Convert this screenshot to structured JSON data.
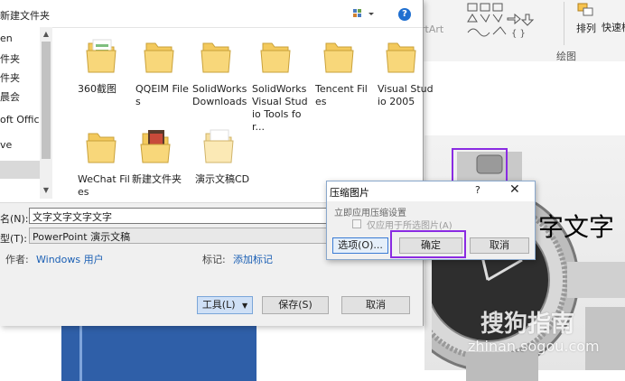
{
  "save_dialog": {
    "toolbar": {
      "new_folder": "新建文件夹"
    },
    "nav": [
      "en",
      "件夹",
      "件夹",
      "晨会",
      "oft Office",
      "ve"
    ],
    "files": [
      {
        "name": "360截图",
        "kind": "folder"
      },
      {
        "name": "QQEIM Files",
        "kind": "folder"
      },
      {
        "name": "SolidWorks Downloads",
        "kind": "folder"
      },
      {
        "name": "SolidWorks Visual Studio Tools for...",
        "kind": "folder"
      },
      {
        "name": "Tencent Files",
        "kind": "folder"
      },
      {
        "name": "Visual Studio 2005",
        "kind": "folder"
      },
      {
        "name": "WeChat Files",
        "kind": "folder"
      },
      {
        "name": "新建文件夹",
        "kind": "folder-photo"
      },
      {
        "name": "演示文稿CD",
        "kind": "folder-light"
      }
    ],
    "filename_label": "名(N):",
    "filename_value": "文字文字文字文字",
    "filetype_label": "型(T):",
    "filetype_value": "PowerPoint 演示文稿",
    "author_label": "作者:",
    "author_value": "Windows 用户",
    "tags_label": "标记:",
    "tags_value": "添加标记",
    "tools_button": "工具(L)",
    "save_button": "保存(S)",
    "cancel_button": "取消"
  },
  "compress_dialog": {
    "title": "压缩图片",
    "help": "?",
    "close": "✕",
    "section": "立即应用压缩设置",
    "checkbox_label": "仅应用于所选图片(A)",
    "checkbox_checked": false,
    "options_button": "选项(O)...",
    "ok_button": "确定",
    "cancel_button": "取消"
  },
  "ribbon": {
    "art_text": "rtArt",
    "arrange": "排列",
    "quick_styles": "快速样",
    "group_label": "绘图"
  },
  "slide": {
    "text": "字文字"
  },
  "watermark": {
    "line1": "搜狗指南",
    "line2": "zhinan.sogou.com"
  },
  "colors": {
    "highlight": "#8a2be2",
    "link": "#1a5fb4",
    "folder": "#f3c95c"
  }
}
